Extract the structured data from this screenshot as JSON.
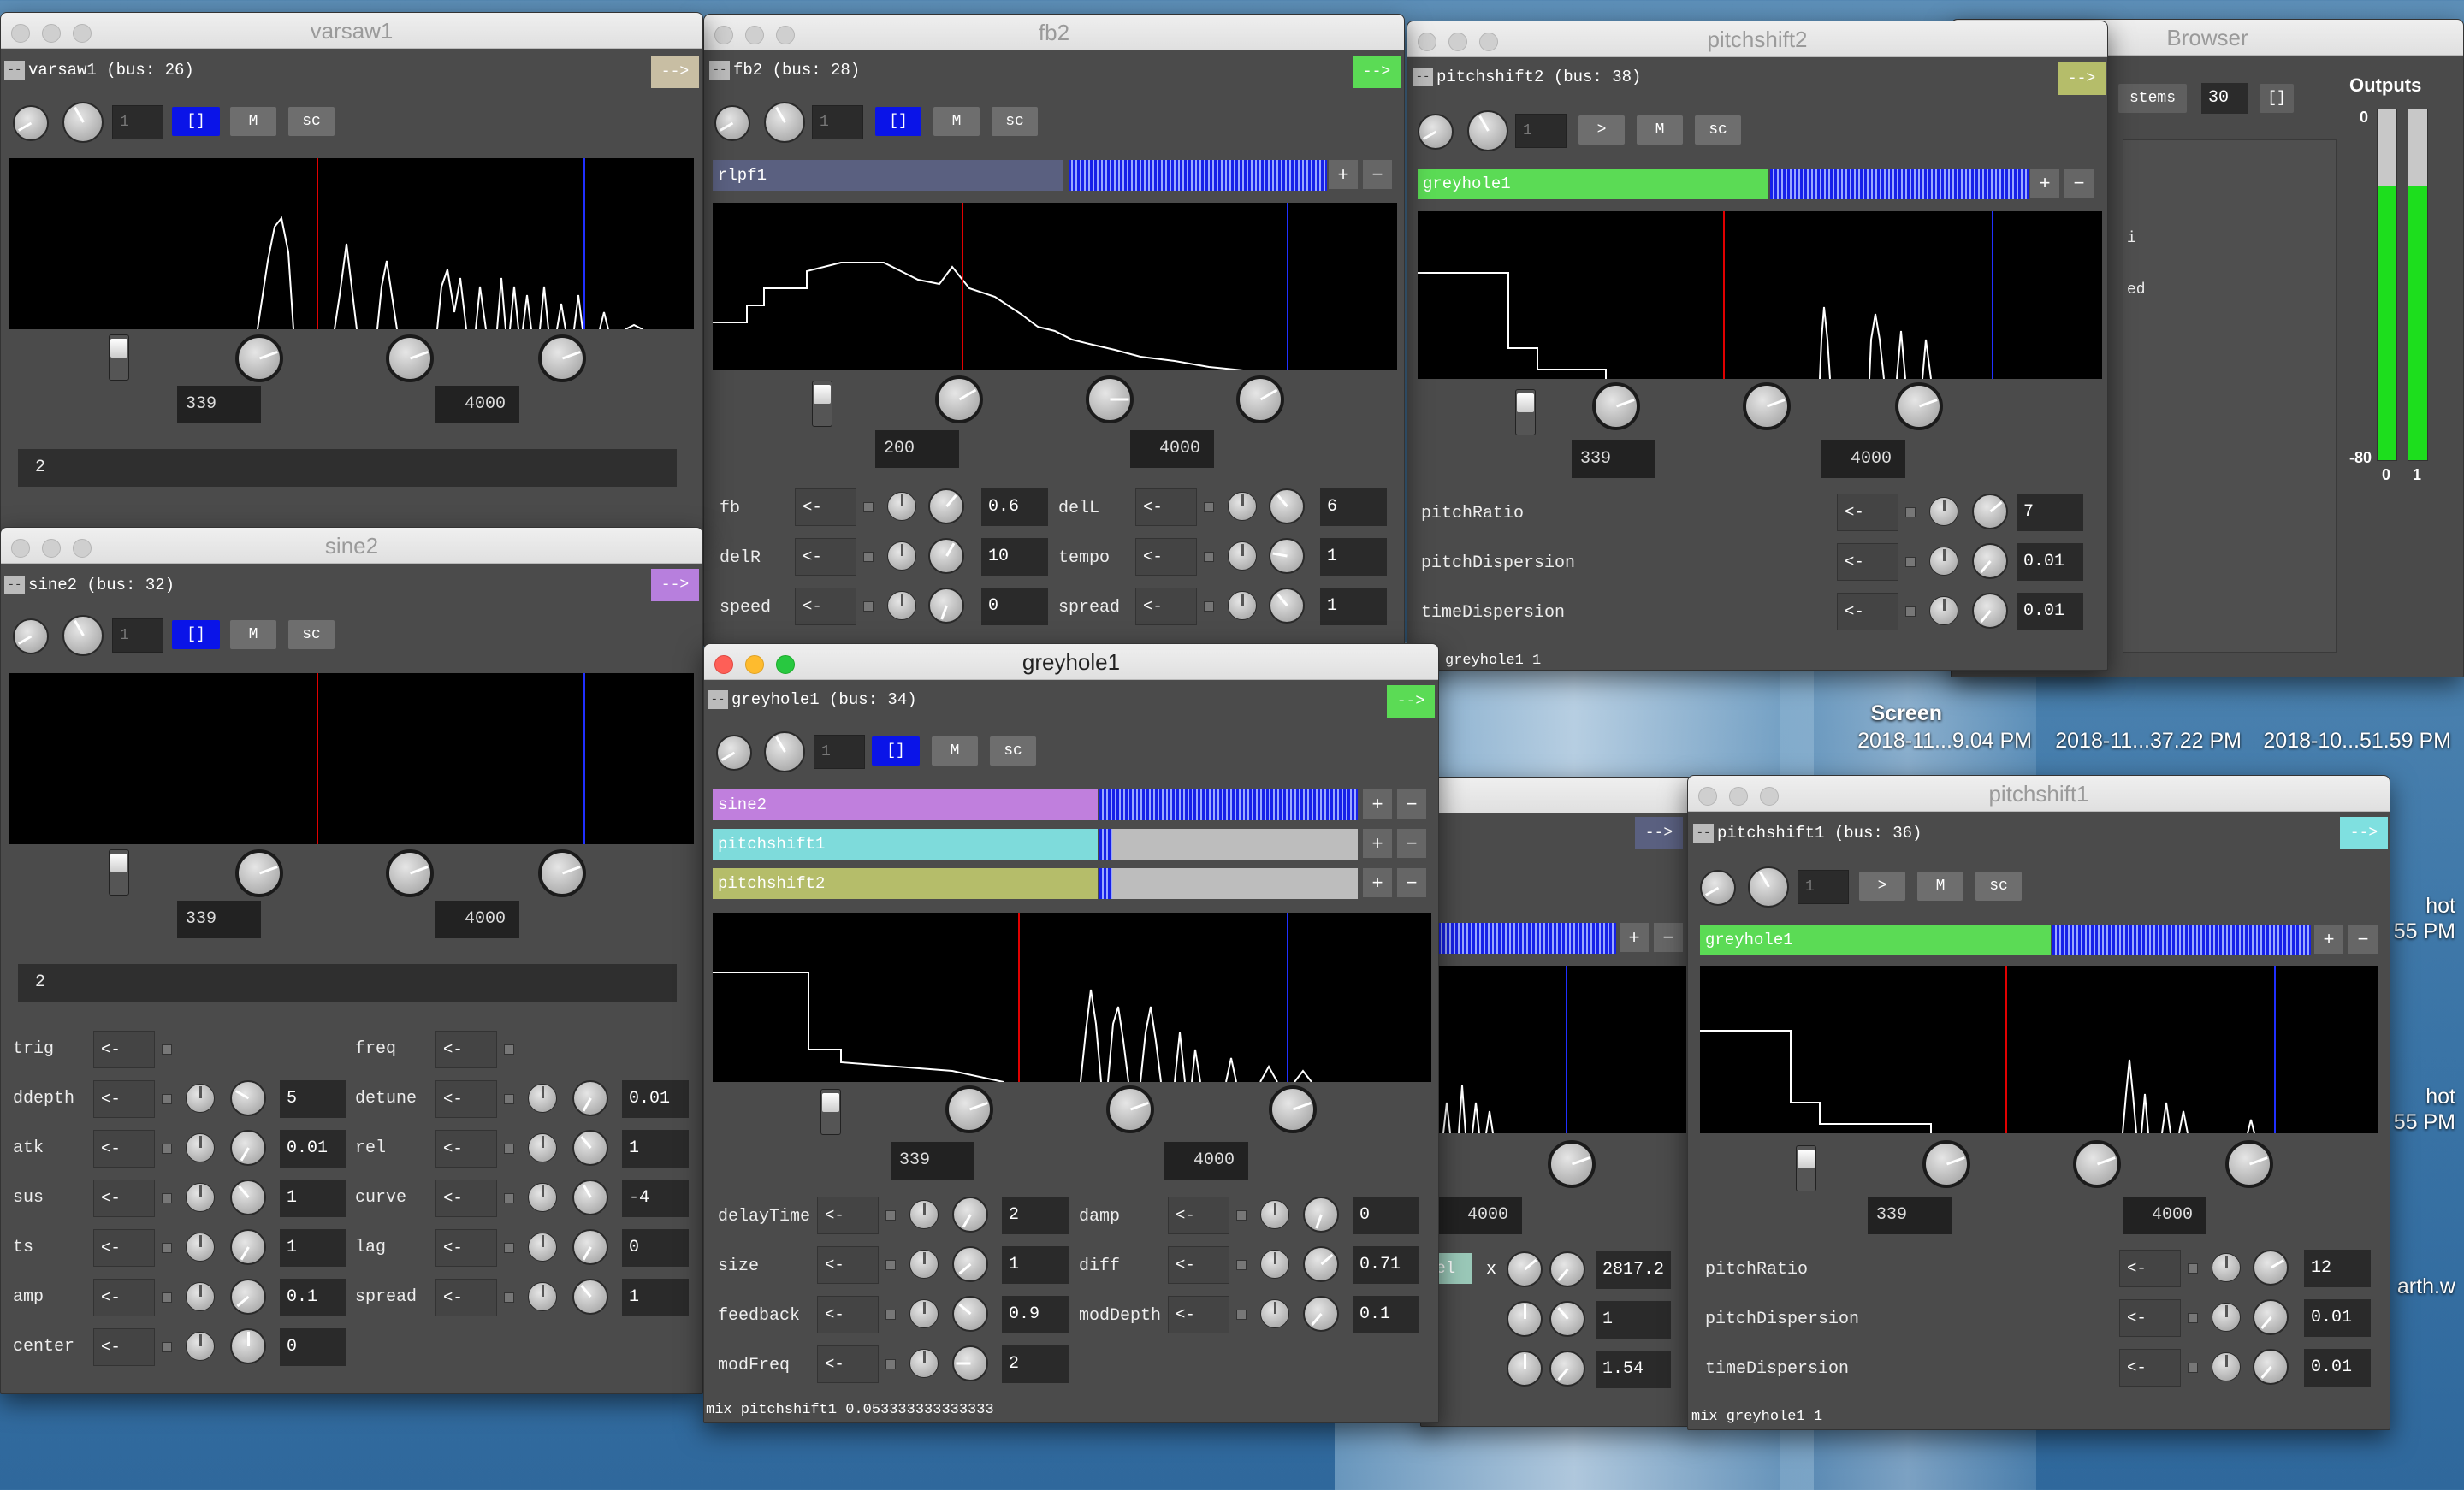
{
  "desktop": {
    "screen_label": "Screen",
    "stamps": [
      "2018-11...9.04 PM",
      "2018-11...37.22 PM",
      "2018-10...51.59 PM"
    ],
    "side_items": [
      "hot",
      "55 PM",
      "hot",
      "55 PM",
      "arth.w"
    ]
  },
  "browser": {
    "title": "Browser",
    "stems_label": "stems",
    "count_value": "30",
    "brackets_label": "[]",
    "outputs_title": "Outputs",
    "scale_top": "0",
    "scale_bottom": "-80",
    "chan_left": "0",
    "chan_right": "1",
    "partial_lines": [
      "i",
      "ed"
    ],
    "meter_levels": [
      0.78,
      0.78
    ]
  },
  "varsaw1": {
    "title": "varsaw1",
    "header": "varsaw1 (bus: 26)",
    "arrow": "-->",
    "numfield": "1",
    "btn_brackets": "[]",
    "btn_m": "M",
    "btn_sc": "sc",
    "low": "339",
    "high": "4000",
    "bar": "2"
  },
  "fb2": {
    "title": "fb2",
    "header": "fb2 (bus: 28)",
    "arrow": "-->",
    "numfield": "1",
    "btn_brackets": "[]",
    "btn_m": "M",
    "btn_sc": "sc",
    "input_bus": "rlpf1",
    "low": "200",
    "high": "4000",
    "params": [
      {
        "name": "fb",
        "value": "0.6"
      },
      {
        "name": "delL",
        "value": "6"
      },
      {
        "name": "delR",
        "value": "10"
      },
      {
        "name": "tempo",
        "value": "1"
      },
      {
        "name": "speed",
        "value": "0"
      },
      {
        "name": "spread",
        "value": "1"
      }
    ],
    "arrow_label": "<-"
  },
  "pitchshift2": {
    "title": "pitchshift2",
    "header": "pitchshift2 (bus: 38)",
    "arrow": "-->",
    "numfield": "1",
    "btn_play": ">",
    "btn_m": "M",
    "btn_sc": "sc",
    "input_bus": "greyhole1",
    "low": "339",
    "high": "4000",
    "params": [
      {
        "name": "pitchRatio",
        "value": "7"
      },
      {
        "name": "pitchDispersion",
        "value": "0.01"
      },
      {
        "name": "timeDispersion",
        "value": "0.01"
      }
    ],
    "arrow_label": "<-",
    "footer": "greyhole1 1"
  },
  "sine2": {
    "title": "sine2",
    "header": "sine2 (bus: 32)",
    "arrow": "-->",
    "numfield": "1",
    "btn_brackets": "[]",
    "btn_m": "M",
    "btn_sc": "sc",
    "low": "339",
    "high": "4000",
    "bar": "2",
    "left_params": [
      {
        "name": "trig",
        "value": ""
      },
      {
        "name": "ddepth",
        "value": "5"
      },
      {
        "name": "atk",
        "value": "0.01"
      },
      {
        "name": "sus",
        "value": "1"
      },
      {
        "name": "ts",
        "value": "1"
      },
      {
        "name": "amp",
        "value": "0.1"
      },
      {
        "name": "center",
        "value": "0"
      }
    ],
    "right_params": [
      {
        "name": "freq",
        "value": ""
      },
      {
        "name": "detune",
        "value": "0.01"
      },
      {
        "name": "rel",
        "value": "1"
      },
      {
        "name": "curve",
        "value": "-4"
      },
      {
        "name": "lag",
        "value": "0"
      },
      {
        "name": "spread",
        "value": "1"
      }
    ],
    "arrow_label": "<-"
  },
  "greyhole1": {
    "title": "greyhole1",
    "header": "greyhole1 (bus: 34)",
    "arrow": "-->",
    "numfield": "1",
    "btn_brackets": "[]",
    "btn_m": "M",
    "btn_sc": "sc",
    "inputs": [
      {
        "name": "sine2",
        "color": "#c07fdd",
        "level": 1.0
      },
      {
        "name": "pitchshift1",
        "color": "#7edbdb",
        "level": 0.05
      },
      {
        "name": "pitchshift2",
        "color": "#b5bd6a",
        "level": 0.05
      }
    ],
    "low": "339",
    "high": "4000",
    "left_params": [
      {
        "name": "delayTime",
        "value": "2"
      },
      {
        "name": "size",
        "value": "1"
      },
      {
        "name": "feedback",
        "value": "0.9"
      },
      {
        "name": "modFreq",
        "value": "2"
      }
    ],
    "right_params": [
      {
        "name": "damp",
        "value": "0"
      },
      {
        "name": "diff",
        "value": "0.71"
      },
      {
        "name": "modDepth",
        "value": "0.1"
      }
    ],
    "arrow_label": "<-",
    "footer": "mix pitchshift1 0.053333333333333"
  },
  "hidden_win": {
    "arrow": "-->",
    "partial_label": "nel",
    "partial_x": "x",
    "values": [
      "2817.2",
      "1",
      "1.54"
    ],
    "high": "4000"
  },
  "pitchshift1": {
    "title": "pitchshift1",
    "header": "pitchshift1 (bus: 36)",
    "arrow": "-->",
    "numfield": "1",
    "btn_play": ">",
    "btn_m": "M",
    "btn_sc": "sc",
    "input_bus": "greyhole1",
    "low": "339",
    "high": "4000",
    "params": [
      {
        "name": "pitchRatio",
        "value": "12"
      },
      {
        "name": "pitchDispersion",
        "value": "0.01"
      },
      {
        "name": "timeDispersion",
        "value": "0.01"
      }
    ],
    "arrow_label": "<-",
    "footer": "mix greyhole1 1"
  },
  "colors": {
    "green_bus": "#5bdb55",
    "purple_arrow": "#b77fdd",
    "cyan_arrow": "#7fe0e0",
    "tan_arrow": "#c8bea3",
    "olive_arrow": "#b5bd6a",
    "meter_blue": "#1620e8",
    "scope_red": "#e00000",
    "scope_blue": "#2030ff",
    "rlpf_bus": "#5a6080"
  }
}
